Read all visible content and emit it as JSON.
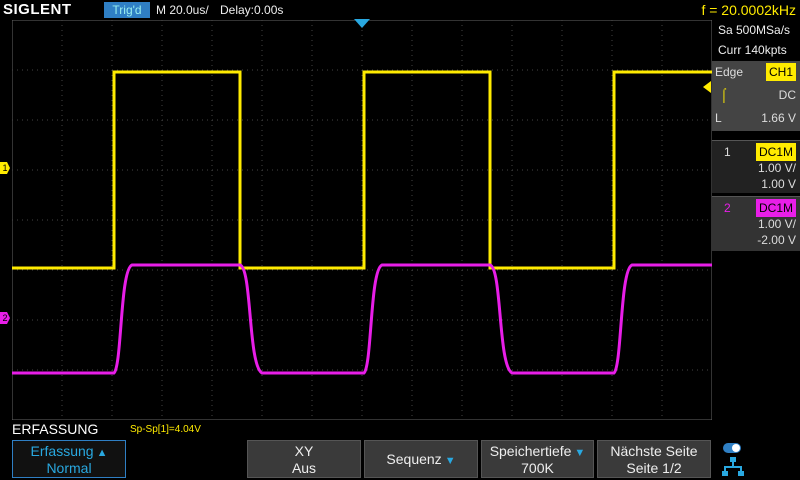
{
  "header": {
    "brand": "SIGLENT",
    "trigger_status": "Trig'd",
    "timebase": "M 20.0us/",
    "delay": "Delay:0.00s",
    "frequency": "f = 20.0002kHz"
  },
  "acquisition": {
    "sample_rate": "Sa 500MSa/s",
    "memory": "Curr 140kpts"
  },
  "trigger": {
    "type_label": "Edge",
    "source": "CH1",
    "coupling": "DC",
    "level_label": "L",
    "level": "1.66 V"
  },
  "channels": [
    {
      "number": "1",
      "coupling": "DC1M",
      "scale": "1.00 V/",
      "offset": "1.00 V",
      "color": "#ffeb00"
    },
    {
      "number": "2",
      "coupling": "DC1M",
      "scale": "1.00 V/",
      "offset": "-2.00 V",
      "color": "#e81ee8"
    }
  ],
  "markers": {
    "ch1": "1",
    "ch2": "2"
  },
  "menu": {
    "name": "ERFASSUNG",
    "measurement": "Sp-Sp[1]=4.04V",
    "buttons": [
      {
        "line1": "Erfassung",
        "line2": "Normal"
      },
      {
        "line1": "XY",
        "line2": "Aus"
      },
      {
        "line1": "Sequenz",
        "line2": ""
      },
      {
        "line1": "Speichertiefe",
        "line2": "700K"
      },
      {
        "line1": "Nächste Seite",
        "line2": "Seite 1/2"
      }
    ]
  },
  "colors": {
    "ch1": "#ffeb00",
    "ch2": "#e81ee8",
    "accent": "#29a8e0"
  }
}
